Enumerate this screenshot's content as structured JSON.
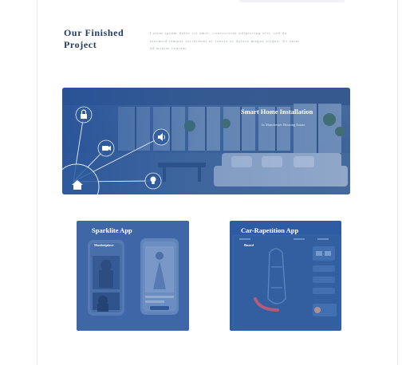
{
  "section": {
    "title_line1": "Our Finished",
    "title_line2": "Project",
    "description": "Lorem ipsum dolor sit amet, consectetur adipiscing elit, sed do eiusmod tempor incididunt ut labore et dolore magna aliqua. Ut enim ad minim veniam."
  },
  "hero": {
    "title": "Smart Home Installation",
    "subtitle": "In Manchester Housing Estate",
    "icons": [
      "lock-icon",
      "camera-icon",
      "speaker-icon",
      "bulb-icon",
      "home-icon"
    ]
  },
  "projects": [
    {
      "title": "Sparklite App",
      "tag": "Marketplace"
    },
    {
      "title": "Car-Rapetition App",
      "tag": "Board"
    }
  ],
  "colors": {
    "title": "#253a63",
    "overlay": "#2c5aa0",
    "body_text": "#9aa3b0"
  }
}
